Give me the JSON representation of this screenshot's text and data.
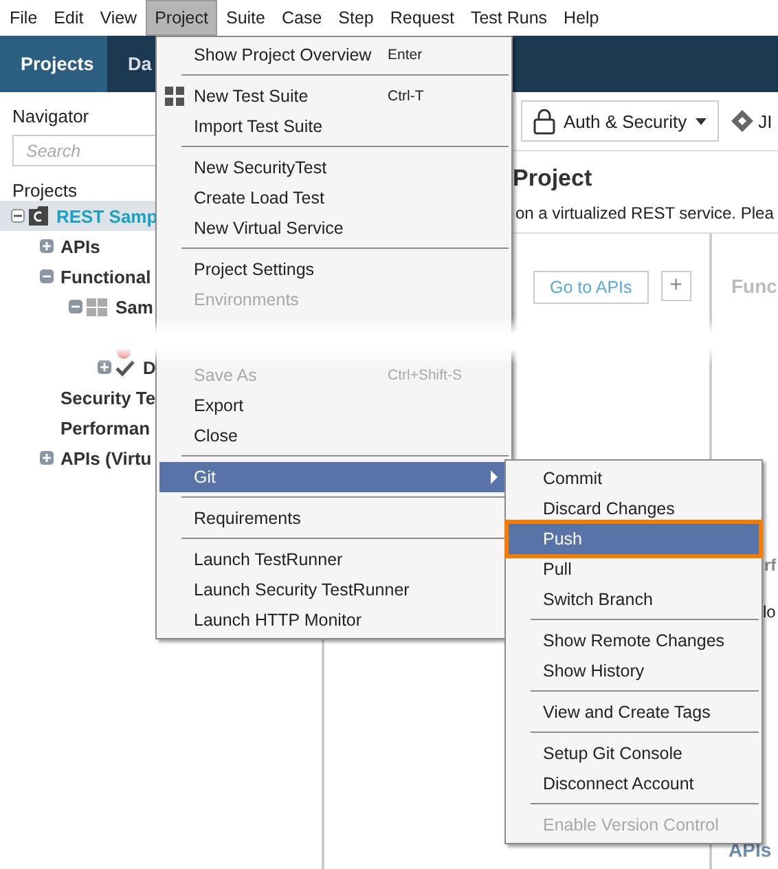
{
  "menubar": [
    {
      "label": "File",
      "selected": false
    },
    {
      "label": "Edit",
      "selected": false
    },
    {
      "label": "View",
      "selected": false
    },
    {
      "label": "Project",
      "selected": true
    },
    {
      "label": "Suite",
      "selected": false
    },
    {
      "label": "Case",
      "selected": false
    },
    {
      "label": "Step",
      "selected": false
    },
    {
      "label": "Request",
      "selected": false
    },
    {
      "label": "Test Runs",
      "selected": false
    },
    {
      "label": "Help",
      "selected": false
    }
  ],
  "tabs": [
    {
      "label": "Projects",
      "selected": true
    },
    {
      "label": "Da",
      "selected": false
    }
  ],
  "navigator": {
    "title": "Navigator",
    "search": {
      "placeholder": "Search"
    },
    "tree_title": "Projects",
    "tree": [
      {
        "label": "REST Samp",
        "kind": "project",
        "selected": true,
        "expanded": true,
        "children": [
          {
            "label": "APIs",
            "selected": false,
            "expanded": false
          },
          {
            "label": "Functional",
            "selected": false,
            "expanded": true,
            "children": [
              {
                "label": "Sam",
                "kind": "suite",
                "selected": false,
                "expanded": true,
                "children": [
                  {
                    "kind": "request",
                    "selected": false
                  },
                  {
                    "label": "D",
                    "kind": "case",
                    "selected": false,
                    "expanded": false
                  }
                ]
              }
            ]
          },
          {
            "label": "Security Te",
            "selected": false
          },
          {
            "label": "Performan",
            "selected": false
          },
          {
            "label": "APIs (Virtu",
            "selected": false,
            "expanded": false
          }
        ]
      }
    ]
  },
  "toolbar": {
    "auth_button": "Auth & Security",
    "jira_button": "JI"
  },
  "overview": {
    "heading": "Project",
    "subtitle": "on a virtualized REST service. Plea",
    "go_button": "Go to APIs",
    "add_button": "+",
    "card_title": "Func",
    "side_text_1": "rf",
    "side_text_2": "lo",
    "side_text_3": "APIs"
  },
  "project_menu": [
    {
      "kind": "item",
      "label": "Show Project Overview",
      "shortcut": "Enter",
      "disabled": false,
      "selected": false
    },
    {
      "kind": "separator"
    },
    {
      "kind": "icon-item",
      "label": "New Test Suite",
      "shortcut": "Ctrl-T",
      "disabled": false,
      "selected": false
    },
    {
      "kind": "item",
      "label": "Import Test Suite",
      "disabled": false,
      "selected": false
    },
    {
      "kind": "separator"
    },
    {
      "kind": "item",
      "label": "New SecurityTest",
      "disabled": false,
      "selected": false
    },
    {
      "kind": "item",
      "label": "Create Load Test",
      "disabled": false,
      "selected": false
    },
    {
      "kind": "item",
      "label": "New Virtual Service",
      "disabled": false,
      "selected": false
    },
    {
      "kind": "separator"
    },
    {
      "kind": "item",
      "label": "Project Settings",
      "disabled": false,
      "selected": false
    },
    {
      "kind": "item",
      "label": "Environments",
      "disabled": true,
      "selected": false
    },
    {
      "kind": "gap"
    },
    {
      "kind": "item",
      "label": "Save As",
      "shortcut": "Ctrl+Shift-S",
      "disabled": true,
      "selected": false
    },
    {
      "kind": "item",
      "label": "Export",
      "disabled": false,
      "selected": false
    },
    {
      "kind": "item",
      "label": "Close",
      "disabled": false,
      "selected": false
    },
    {
      "kind": "separator"
    },
    {
      "kind": "submenu",
      "label": "Git",
      "disabled": false,
      "selected": true
    },
    {
      "kind": "separator"
    },
    {
      "kind": "item",
      "label": "Requirements",
      "disabled": false,
      "selected": false
    },
    {
      "kind": "separator"
    },
    {
      "kind": "item",
      "label": "Launch TestRunner",
      "disabled": false,
      "selected": false
    },
    {
      "kind": "item",
      "label": "Launch Security TestRunner",
      "disabled": false,
      "selected": false
    },
    {
      "kind": "item",
      "label": "Launch HTTP Monitor",
      "disabled": false,
      "selected": false
    }
  ],
  "git_menu": [
    {
      "kind": "item",
      "label": "Commit",
      "disabled": false,
      "selected": false
    },
    {
      "kind": "item",
      "label": "Discard Changes",
      "disabled": false,
      "selected": false
    },
    {
      "kind": "item",
      "label": "Push",
      "disabled": false,
      "selected": true,
      "outlined": true
    },
    {
      "kind": "item",
      "label": "Pull",
      "disabled": false,
      "selected": false
    },
    {
      "kind": "item",
      "label": "Switch Branch",
      "disabled": false,
      "selected": false
    },
    {
      "kind": "separator"
    },
    {
      "kind": "item",
      "label": "Show Remote Changes",
      "disabled": false,
      "selected": false
    },
    {
      "kind": "item",
      "label": "Show History",
      "disabled": false,
      "selected": false
    },
    {
      "kind": "separator"
    },
    {
      "kind": "item",
      "label": "View and Create Tags",
      "disabled": false,
      "selected": false
    },
    {
      "kind": "separator"
    },
    {
      "kind": "item",
      "label": "Setup Git Console",
      "disabled": false,
      "selected": false
    },
    {
      "kind": "item",
      "label": "Disconnect Account",
      "disabled": false,
      "selected": false
    },
    {
      "kind": "separator"
    },
    {
      "kind": "item",
      "label": "Enable Version Control",
      "disabled": true,
      "selected": false
    }
  ]
}
